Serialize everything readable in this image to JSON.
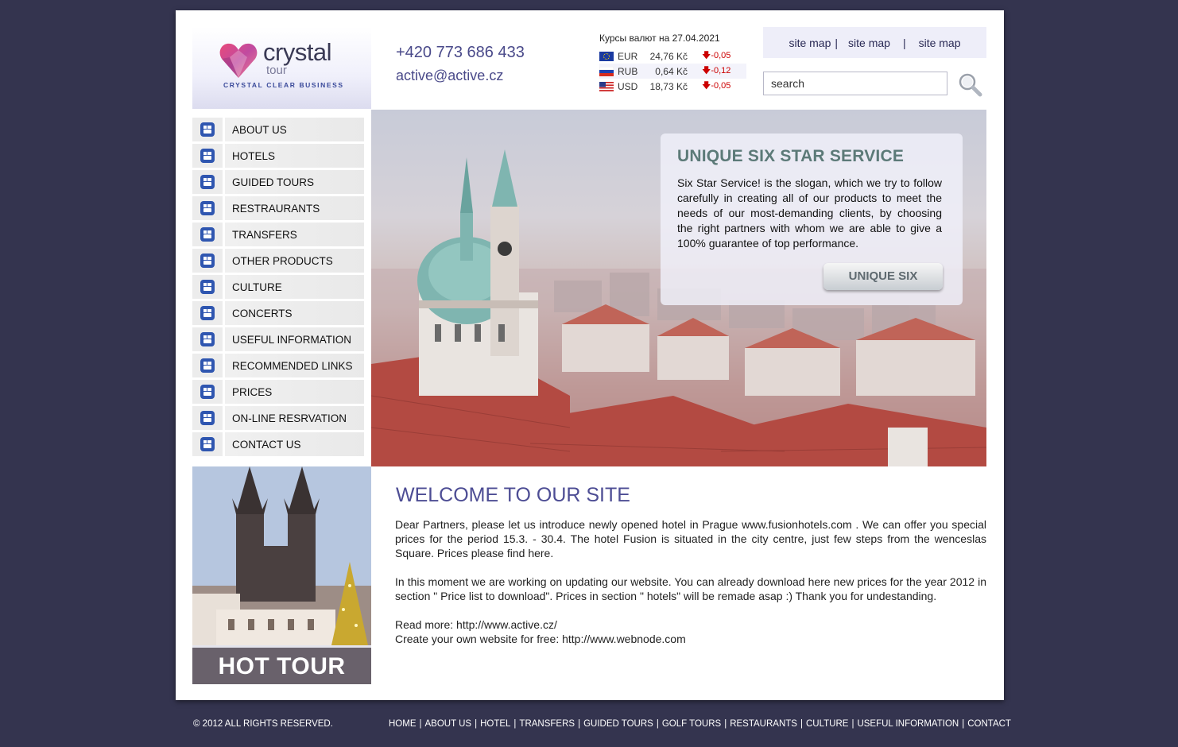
{
  "logo": {
    "brand": "crystal",
    "sub": "tour",
    "tagline": "CRYSTAL CLEAR BUSINESS"
  },
  "contact": {
    "phone": "+420 773 686 433",
    "email": "active@active.cz"
  },
  "rates": {
    "title": "Курсы валют на 27.04.2021",
    "items": [
      {
        "code": "EUR",
        "value": "24,76 Kč",
        "change": "-0,05",
        "flag": "eu-flag-icon"
      },
      {
        "code": "RUB",
        "value": "0,64 Kč",
        "change": "-0,12",
        "flag": "ru-flag-icon"
      },
      {
        "code": "USD",
        "value": "18,73 Kč",
        "change": "-0,05",
        "flag": "us-flag-icon"
      }
    ]
  },
  "sitemap_links": [
    "site map",
    "site map",
    "site map"
  ],
  "search": {
    "value": "search"
  },
  "menu": [
    "ABOUT US",
    "HOTELS",
    "GUIDED TOURS",
    "RESTRAURANTS",
    "TRANSFERS",
    "OTHER PRODUCTS",
    "CULTURE",
    "CONCERTS",
    "USEFUL INFORMATION",
    "RECOMMENDED LINKS",
    "PRICES",
    "ON-LINE RESRVATION",
    "CONTACT US"
  ],
  "hero": {
    "title": "UNIQUE SIX STAR SERVICE",
    "text": "Six Star Service! is the slogan, which we try to follow carefully in creating all of our products to meet the needs of our most-demanding clients, by choosing the right partners with whom we are able to give a 100% guarantee of top performance.",
    "button": "UNIQUE SIX"
  },
  "hot_tour": {
    "label": "HOT TOUR"
  },
  "content": {
    "title": "WELCOME TO OUR SITE",
    "para1": "Dear Partners, please let us introduce newly opened hotel in Prague www.fusionhotels.com . We can offer you special prices for the period 15.3. - 30.4. The hotel Fusion is situated in the city centre, just few steps from the wenceslas Square. Prices please find here.",
    "para2": "In this moment we are working on updating our website. You can already download here new prices for the year 2012 in section \" Price list to download\". Prices in section \" hotels\" will be remade asap :) Thank you for undestanding.",
    "read_more": "Read more: http://www.active.cz/",
    "create": "Create your own website for free: http://www.webnode.com"
  },
  "footer": {
    "copyright": "© 2012 ALL RIGHTS RESERVED.",
    "links": [
      "HOME",
      "ABOUT US",
      "HOTEL",
      "TRANSFERS",
      "GUIDED TOURS",
      "GOLF TOURS",
      "RESTAURANTS",
      "CULTURE",
      "USEFUL INFORMATION",
      "CONTACT"
    ]
  },
  "colors": {
    "background": "#34344f",
    "accent": "#4d4d94",
    "menu_icon": "#2f56b0",
    "change_down": "#cc0000"
  }
}
